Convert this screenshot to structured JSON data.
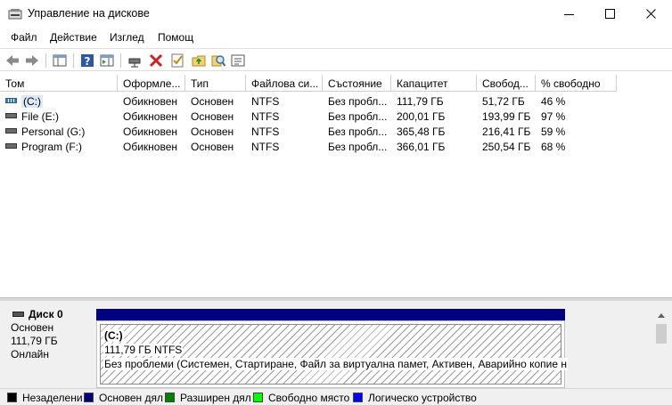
{
  "window": {
    "title": "Управление на дискове"
  },
  "menu": [
    "Файл",
    "Действие",
    "Изглед",
    "Помощ"
  ],
  "toolbar": {
    "buttons": [
      "back-icon",
      "forward-icon",
      "console-tree-icon",
      "help-icon",
      "show-pane-icon",
      "connect-drive-icon",
      "delete-icon",
      "check-icon",
      "folder-up-icon",
      "search-icon",
      "properties-icon"
    ],
    "colors": {
      "delete": "#d21f1f",
      "help": "#2a57a8"
    }
  },
  "volumes": {
    "headers": [
      "Том",
      "Оформле...",
      "Тип",
      "Файлова си...",
      "Състояние",
      "Капацитет",
      "Свобод...",
      "% свободно"
    ],
    "rows": [
      {
        "name": "(C:)",
        "layout": "Обикновен",
        "type": "Основен",
        "fs": "NTFS",
        "status": "Без пробл...",
        "capacity": "111,79 ГБ",
        "free": "51,72 ГБ",
        "pct": "46 %",
        "system": true
      },
      {
        "name": "File (E:)",
        "layout": "Обикновен",
        "type": "Основен",
        "fs": "NTFS",
        "status": "Без пробл...",
        "capacity": "200,01 ГБ",
        "free": "193,99 ГБ",
        "pct": "97 %",
        "system": false
      },
      {
        "name": "Personal (G:)",
        "layout": "Обикновен",
        "type": "Основен",
        "fs": "NTFS",
        "status": "Без пробл...",
        "capacity": "365,48 ГБ",
        "free": "216,41 ГБ",
        "pct": "59 %",
        "system": false
      },
      {
        "name": "Program (F:)",
        "layout": "Обикновен",
        "type": "Основен",
        "fs": "NTFS",
        "status": "Без пробл...",
        "capacity": "366,01 ГБ",
        "free": "250,54 ГБ",
        "pct": "68 %",
        "system": false
      }
    ]
  },
  "disk": {
    "name": "Диск 0",
    "type": "Основен",
    "size": "111,79 ГБ",
    "state": "Онлайн",
    "partition": {
      "name": "(C:)",
      "size_fs": "111,79 ГБ NTFS",
      "status": "Без проблеми (Системен, Стартиране, Файл за виртуална памет, Активен, Аварийно копие н"
    }
  },
  "legend": [
    {
      "label": "Незаделени",
      "color": "#000000"
    },
    {
      "label": "Основен дял",
      "color": "#000080"
    },
    {
      "label": "Разширен дял",
      "color": "#008000"
    },
    {
      "label": "Свободно място",
      "color": "#00ff00"
    },
    {
      "label": "Логическо устройство",
      "color": "#0000ff"
    }
  ]
}
